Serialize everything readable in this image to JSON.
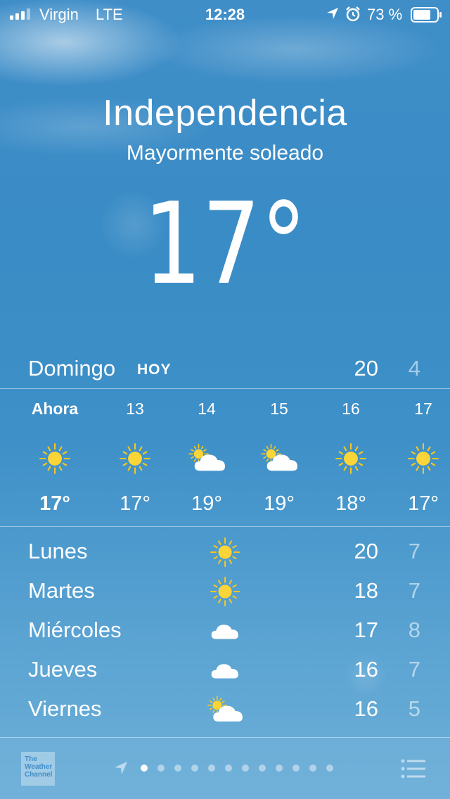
{
  "status_bar": {
    "carrier": "Virgin",
    "network": "LTE",
    "time": "12:28",
    "battery_percent": "73 %"
  },
  "location": {
    "city": "Independencia",
    "condition": "Mayormente soleado",
    "current_temp": "17°"
  },
  "today": {
    "day": "Domingo",
    "label": "HOY",
    "high": "20",
    "low": "4"
  },
  "hourly": [
    {
      "label": "Ahora",
      "icon": "sun-icon",
      "temp": "17°"
    },
    {
      "label": "13",
      "icon": "sun-icon",
      "temp": "17°"
    },
    {
      "label": "14",
      "icon": "partly-cloudy-icon",
      "temp": "19°"
    },
    {
      "label": "15",
      "icon": "partly-cloudy-icon",
      "temp": "19°"
    },
    {
      "label": "16",
      "icon": "sun-icon",
      "temp": "18°"
    },
    {
      "label": "17",
      "icon": "sun-icon",
      "temp": "17°"
    }
  ],
  "daily": [
    {
      "day": "Lunes",
      "icon": "sun-icon",
      "high": "20",
      "low": "7"
    },
    {
      "day": "Martes",
      "icon": "sun-icon",
      "high": "18",
      "low": "7"
    },
    {
      "day": "Miércoles",
      "icon": "cloud-icon",
      "high": "17",
      "low": "8"
    },
    {
      "day": "Jueves",
      "icon": "cloud-icon",
      "high": "16",
      "low": "7"
    },
    {
      "day": "Viernes",
      "icon": "partly-cloudy-icon",
      "high": "16",
      "low": "5"
    }
  ],
  "bottom_bar": {
    "logo_lines": [
      "The",
      "Weather",
      "Channel"
    ],
    "page_count": 12,
    "active_page": 0
  },
  "colors": {
    "sun": "#f8c81c",
    "sun_core": "#fbd437"
  }
}
